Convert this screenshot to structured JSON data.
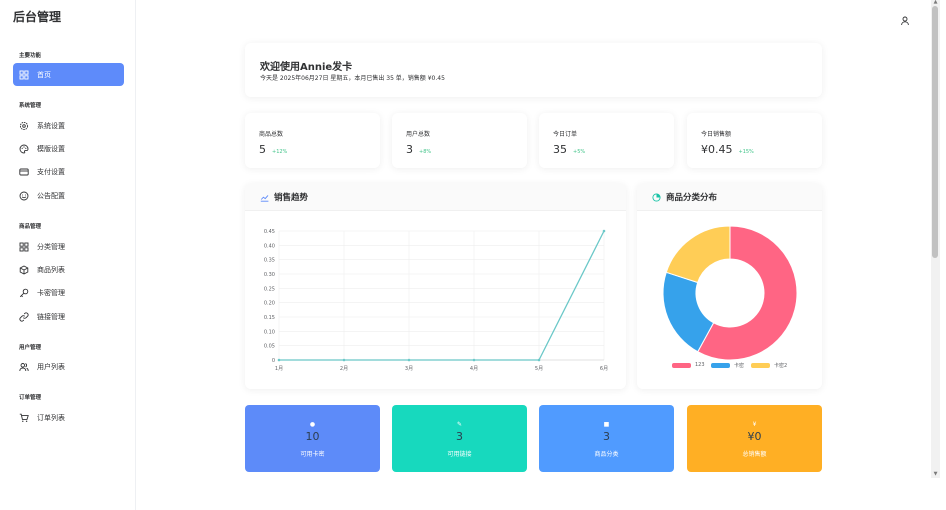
{
  "app": {
    "title": "后台管理"
  },
  "sidebar": {
    "sections": [
      {
        "title": "主要功能",
        "items": [
          {
            "label": "首页",
            "icon": "grid-icon",
            "active": true
          }
        ]
      },
      {
        "title": "系统管理",
        "items": [
          {
            "label": "系统设置",
            "icon": "gear-icon"
          },
          {
            "label": "模版设置",
            "icon": "palette-icon"
          },
          {
            "label": "支付设置",
            "icon": "card-icon"
          },
          {
            "label": "公告配置",
            "icon": "smile-icon"
          }
        ]
      },
      {
        "title": "商品管理",
        "items": [
          {
            "label": "分类管理",
            "icon": "grid-icon"
          },
          {
            "label": "商品列表",
            "icon": "box-icon"
          },
          {
            "label": "卡密管理",
            "icon": "key-icon"
          },
          {
            "label": "链接管理",
            "icon": "link-icon"
          }
        ]
      },
      {
        "title": "用户管理",
        "items": [
          {
            "label": "用户列表",
            "icon": "users-icon"
          }
        ]
      },
      {
        "title": "订单管理",
        "items": [
          {
            "label": "订单列表",
            "icon": "cart-icon"
          }
        ]
      }
    ]
  },
  "welcome": {
    "title": "欢迎使用Annie发卡",
    "subtitle": "今天是 2025年06月27日 星期五，本月已售出 35 单，销售额 ¥0.45"
  },
  "stats": [
    {
      "label": "商品总数",
      "value": "5",
      "change": "+12%"
    },
    {
      "label": "用户总数",
      "value": "3",
      "change": "+8%"
    },
    {
      "label": "今日订单",
      "value": "35",
      "change": "+5%"
    },
    {
      "label": "今日销售额",
      "value": "¥0.45",
      "change": "+15%"
    }
  ],
  "sales_panel": {
    "title": "销售趋势"
  },
  "category_panel": {
    "title": "商品分类分布"
  },
  "chart_data": [
    {
      "type": "line",
      "title": "",
      "x": [
        "1月",
        "2月",
        "3月",
        "4月",
        "5月",
        "6月"
      ],
      "series": [
        {
          "values": [
            0,
            0,
            0,
            0,
            0,
            0.45
          ],
          "color": "#6bc8c8"
        }
      ],
      "ylim": [
        0,
        0.45
      ],
      "yticks": [
        "0",
        "0.05",
        "0.10",
        "0.15",
        "0.20",
        "0.25",
        "0.30",
        "0.35",
        "0.40",
        "0.45"
      ],
      "grid": true
    },
    {
      "type": "pie",
      "title": "",
      "donut": true,
      "slices": [
        {
          "name": "123",
          "value": 58,
          "color": "#ff6584"
        },
        {
          "name": "卡密",
          "value": 22,
          "color": "#36a2eb"
        },
        {
          "name": "卡密2",
          "value": 20,
          "color": "#ffcd56"
        }
      ],
      "legend": "bottom"
    }
  ],
  "quick": [
    {
      "icon": "key-icon",
      "value": "10",
      "label": "可用卡密",
      "color": "#5d8bf9"
    },
    {
      "icon": "pencil-icon",
      "value": "3",
      "label": "可用链接",
      "color": "#17d9be"
    },
    {
      "icon": "tag-icon",
      "value": "3",
      "label": "商品分类",
      "color": "#509bff"
    },
    {
      "icon": "money-icon",
      "value": "¥0",
      "label": "总销售额",
      "color": "#ffaf24"
    }
  ]
}
